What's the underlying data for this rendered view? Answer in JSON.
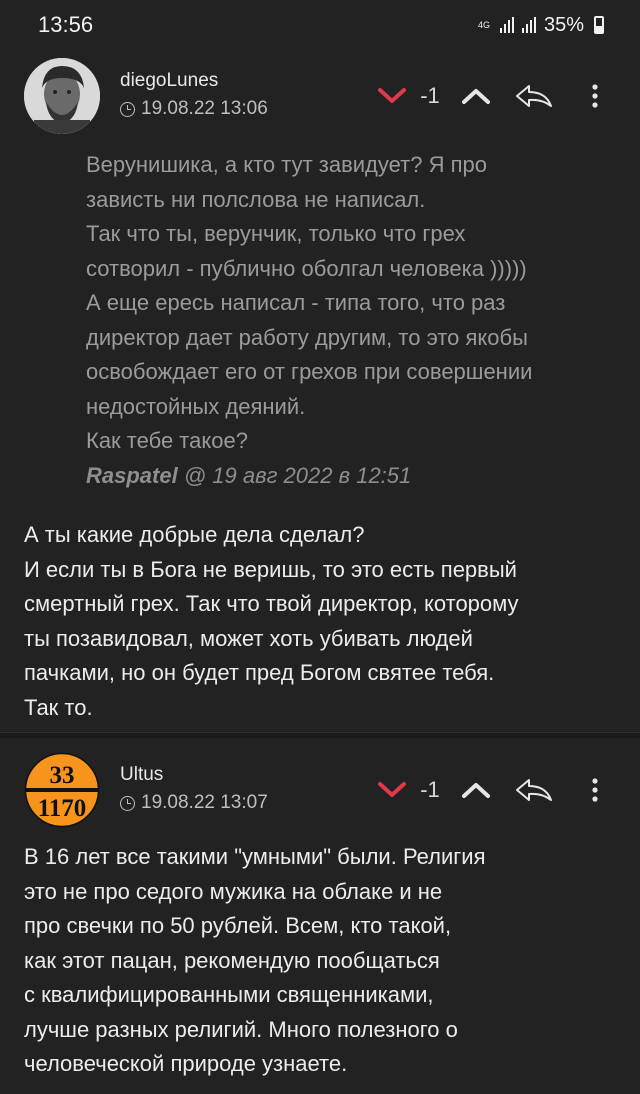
{
  "status_bar": {
    "time": "13:56",
    "network": "4G",
    "battery": "35%"
  },
  "comments": [
    {
      "username": "diegoLunes",
      "date": "19.08.22 13:06",
      "score": "-1",
      "quote": {
        "lines": [
          "Верунишика, а кто тут завидует? Я про",
          "зависть ни полслова не написал.",
          "Так что ты, верунчик, только что грех",
          "сотворил - публично оболгал человека )))))",
          "А еще ересь написал - типа того, что раз",
          "директор дает работу другим, то это якобы",
          "освобождает его от грехов при совершении",
          "недостойных деяний.",
          "Как тебе такое?"
        ],
        "author": "Raspatel",
        "attribution": "@ 19 авг 2022 в 12:51"
      },
      "text_lines": [
        "А ты какие добрые дела сделал?",
        "И если ты в Бога не веришь, то это есть первый",
        "смертный грех. Так что твой директор, которому",
        "ты позавидовал, может хоть убивать людей",
        "пачками, но он будет пред Богом святее тебя.",
        "Так то."
      ]
    },
    {
      "username": "Ultus",
      "date": "19.08.22 13:07",
      "score": "-1",
      "avatar_text": {
        "top": "33",
        "bottom": "1170"
      },
      "text_lines": [
        "В 16 лет все такими \"умными\" были. Религия",
        "это не про седого мужика на облаке и не",
        "про свечки по 50 рублей. Всем, кто такой,",
        "как этот пацан, рекомендую пообщаться",
        "с квалифицированными священниками,",
        "лучше разных религий. Много полезного о",
        "человеческой природе узнаете."
      ]
    }
  ],
  "colors": {
    "background": "#222223",
    "downvote": "#e0394a",
    "quote_text": "#9b9b9b",
    "body_text": "#ececec",
    "orange_plate": "#f7941d"
  },
  "icons": [
    "downvote-icon",
    "upvote-icon",
    "reply-icon",
    "more-icon",
    "clock-icon"
  ]
}
